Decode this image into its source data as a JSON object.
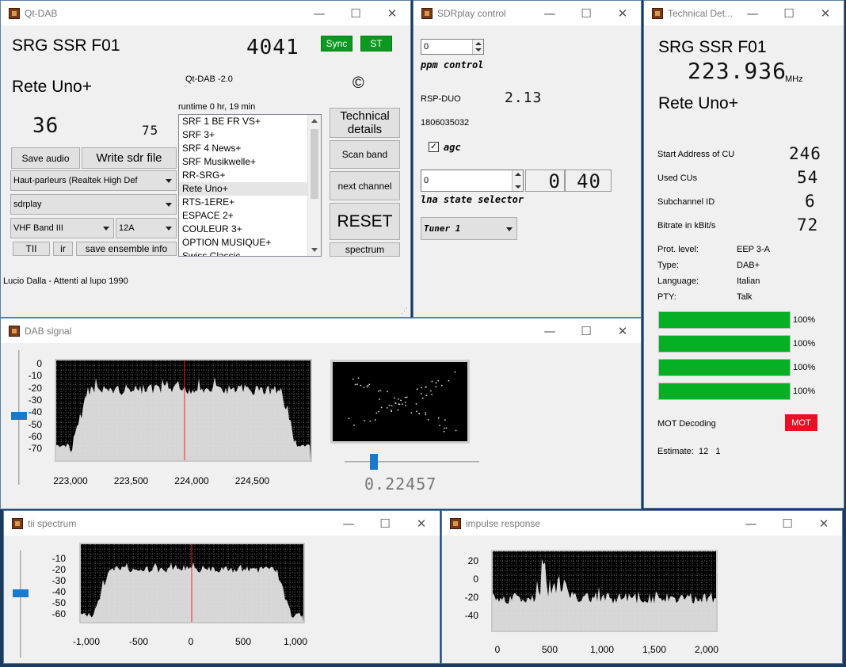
{
  "main": {
    "title": "Qt-DAB",
    "ensemble": "SRG SSR F01",
    "ensemble_id": "4041",
    "sync_label": "Sync",
    "st_label": "ST",
    "service": "Rete Uno+",
    "version": "Qt-DAB -2.0",
    "copyright": "©",
    "runtime": "runtime 0 hr, 19 min",
    "value_a": "36",
    "value_b": "75",
    "save_audio": "Save audio",
    "write_sdr": "Write sdr file",
    "audio_device": "Haut-parleurs (Realtek High Def",
    "device": "sdrplay",
    "band": "VHF Band III",
    "channel": "12A",
    "tii": "TII",
    "ir": "ir",
    "save_ensemble": "save ensemble info",
    "technical_details": "Technical details",
    "scan_band": "Scan band",
    "next_channel": "next channel",
    "reset": "RESET",
    "spectrum": "spectrum",
    "dynamic_label": "Lucio Dalla - Attenti al lupo 1990",
    "services": [
      "SRF 1 BE FR VS+",
      "SRF 3+",
      "SRF 4 News+",
      "SRF Musikwelle+",
      "RR-SRG+",
      "Rete Uno+",
      "RTS-1ERE+",
      "ESPACE 2+",
      "COULEUR 3+",
      "OPTION MUSIQUE+",
      "Swiss Classic"
    ]
  },
  "sdrplay": {
    "title": "SDRplay control",
    "ppm_value": "0",
    "ppm_label": "ppm control",
    "model": "RSP-DUO",
    "api_version": "2.13",
    "serial": "1806035032",
    "agc_label": "agc",
    "agc_checked": true,
    "lna_value": "0",
    "gr_value": "0",
    "lna_lcd": "40",
    "lna_label": "lna state selector",
    "tuner": "Tuner 1"
  },
  "technical": {
    "title": "Technical Det...",
    "ensemble": "SRG SSR F01",
    "frequency": "223.936",
    "freq_unit": "MHz",
    "service": "Rete Uno+",
    "start_label": "Start Address of CU",
    "start_value": "246",
    "used_label": "Used CUs",
    "used_value": "54",
    "sub_label": "Subchannel ID",
    "sub_value": "6",
    "bitrate_label": "Bitrate in kBit/s",
    "bitrate_value": "72",
    "prot_label": "Prot. level:",
    "prot_value": "EEP 3-A",
    "type_label": "Type:",
    "type_value": "DAB+",
    "lang_label": "Language:",
    "lang_value": "Italian",
    "pty_label": "PTY:",
    "pty_value": "Talk",
    "bars": [
      {
        "value": 100,
        "text": "100%"
      },
      {
        "value": 100,
        "text": "100%"
      },
      {
        "value": 100,
        "text": "100%"
      },
      {
        "value": 100,
        "text": "100%"
      }
    ],
    "mot_label": "MOT Decoding",
    "mot_badge": "MOT",
    "estimate": "Estimate:  12   1",
    "mot_color": "#e81123"
  },
  "dab_signal": {
    "title": "DAB signal",
    "y_ticks": [
      "0",
      "-10",
      "-20",
      "-30",
      "-40",
      "-50",
      "-60",
      "-70"
    ],
    "x_ticks": [
      "223,000",
      "223,500",
      "224,000",
      "224,500"
    ],
    "slider_value": "0.22457"
  },
  "tii": {
    "title": "tii spectrum",
    "y_ticks": [
      "-10",
      "-20",
      "-30",
      "-40",
      "-50",
      "-60"
    ],
    "x_ticks": [
      "-1,000",
      "-500",
      "0",
      "500",
      "1,000"
    ]
  },
  "impulse": {
    "title": "impulse response",
    "y_ticks": [
      "20",
      "0",
      "-20",
      "-40"
    ],
    "x_ticks": [
      "0",
      "500",
      "1,000",
      "1,500",
      "2,000"
    ]
  },
  "colors": {
    "accent": "#1979ca",
    "green": "#0a9a1f",
    "marker": "#ff2020"
  },
  "window_icons": {
    "minimize": "minimize-icon",
    "maximize": "maximize-icon",
    "close": "close-icon"
  }
}
